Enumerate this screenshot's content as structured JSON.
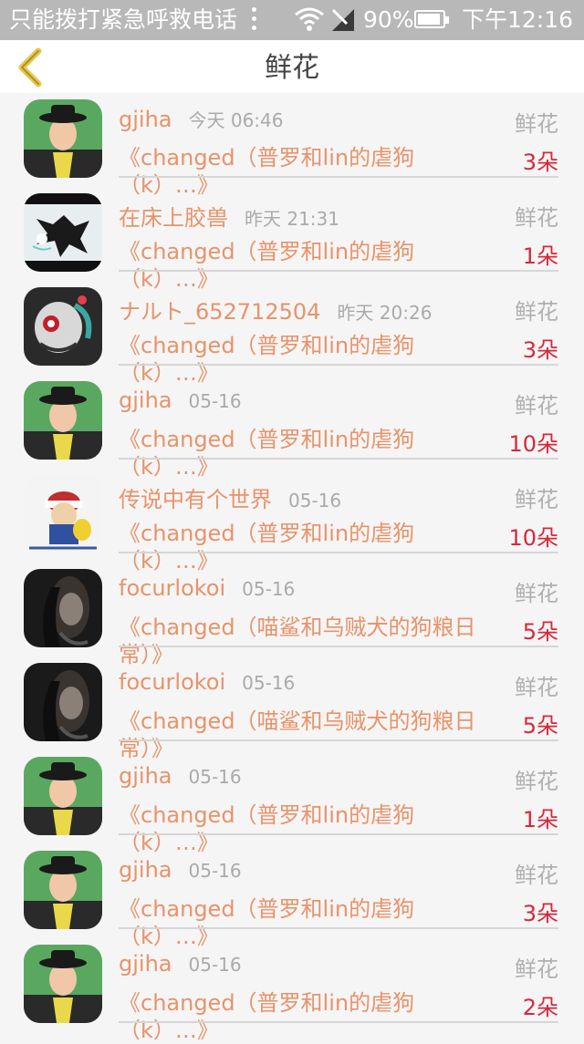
{
  "status": {
    "carrier": "只能拨打紧急呼救电话",
    "battery": "90%",
    "time": "下午12:16"
  },
  "header": {
    "title": "鲜花"
  },
  "items": [
    {
      "name": "gjiha",
      "time": "今天 06:46",
      "gift": "鲜花",
      "work": "《changed（普罗和lin的虐狗（k）…》",
      "count": "3朵",
      "avatar": "girl"
    },
    {
      "name": "在床上胶兽",
      "time": "昨天 21:31",
      "gift": "鲜花",
      "work": "《changed（普罗和lin的虐狗（k）…》",
      "count": "1朵",
      "avatar": "beast"
    },
    {
      "name": "ナルト_652712504",
      "time": "昨天 20:26",
      "gift": "鲜花",
      "work": "《changed（普罗和lin的虐狗（k）…》",
      "count": "3朵",
      "avatar": "mask"
    },
    {
      "name": "gjiha",
      "time": "05-16",
      "gift": "鲜花",
      "work": "《changed（普罗和lin的虐狗（k）…》",
      "count": "10朵",
      "avatar": "girl"
    },
    {
      "name": "传说中有个世界",
      "time": "05-16",
      "gift": "鲜花",
      "work": "《changed（普罗和lin的虐狗（k）…》",
      "count": "10朵",
      "avatar": "pokemon"
    },
    {
      "name": "focurlokoi",
      "time": "05-16",
      "gift": "鲜花",
      "work": "《changed（喵鲨和乌贼犬的狗粮日常）》",
      "count": "5朵",
      "avatar": "woman"
    },
    {
      "name": "focurlokoi",
      "time": "05-16",
      "gift": "鲜花",
      "work": "《changed（喵鲨和乌贼犬的狗粮日常）》",
      "count": "5朵",
      "avatar": "woman"
    },
    {
      "name": "gjiha",
      "time": "05-16",
      "gift": "鲜花",
      "work": "《changed（普罗和lin的虐狗（k）…》",
      "count": "1朵",
      "avatar": "girl"
    },
    {
      "name": "gjiha",
      "time": "05-16",
      "gift": "鲜花",
      "work": "《changed（普罗和lin的虐狗（k）…》",
      "count": "3朵",
      "avatar": "girl"
    },
    {
      "name": "gjiha",
      "time": "05-16",
      "gift": "鲜花",
      "work": "《changed（普罗和lin的虐狗（k）…》",
      "count": "2朵",
      "avatar": "girl"
    }
  ]
}
